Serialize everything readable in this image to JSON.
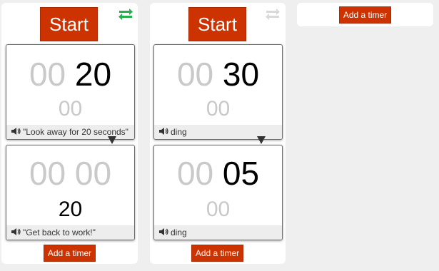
{
  "colors": {
    "accent": "#cc3300",
    "repeat_active": "#22b14c",
    "repeat_inactive": "#d9d9d9",
    "dim_digits": "#c9c9c9"
  },
  "columns": [
    {
      "start_label": "Start",
      "repeat_icon": "repeat-icon",
      "repeat_active": true,
      "timers": [
        {
          "minutes": "00",
          "seconds": "20",
          "sub": "00",
          "sound": "\"Look away for 20 seconds\""
        },
        {
          "minutes": "00",
          "seconds": "00",
          "sub": "20",
          "sound": "\"Get back to work!\""
        }
      ],
      "add_label": "Add a timer"
    },
    {
      "start_label": "Start",
      "repeat_icon": "repeat-icon",
      "repeat_active": false,
      "timers": [
        {
          "minutes": "00",
          "seconds": "30",
          "sub": "00",
          "sound": "ding"
        },
        {
          "minutes": "00",
          "seconds": "05",
          "sub": "00",
          "sound": "ding"
        }
      ],
      "add_label": "Add a timer"
    },
    {
      "add_label": "Add a timer"
    }
  ]
}
